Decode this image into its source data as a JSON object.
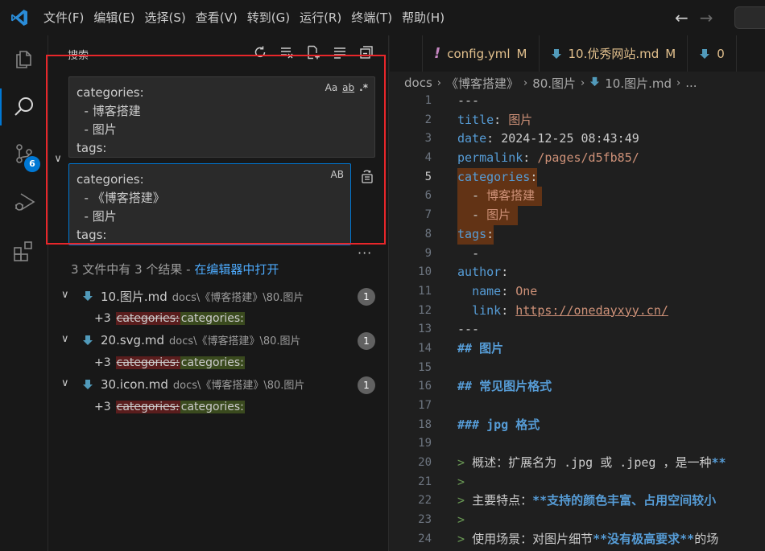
{
  "menu": [
    "文件(F)",
    "编辑(E)",
    "选择(S)",
    "查看(V)",
    "转到(G)",
    "运行(R)",
    "终端(T)",
    "帮助(H)"
  ],
  "activity": {
    "source_control_badge": "6"
  },
  "sidebar": {
    "title": "搜索",
    "search_lines": [
      "categories:",
      "  - 博客搭建",
      "  - 图片",
      "tags:"
    ],
    "search_opts": {
      "case": "Aa",
      "word": "ab",
      "regex": ".*"
    },
    "replace_lines": [
      "categories:",
      "  - 《博客搭建》",
      "  - 图片",
      "tags:"
    ],
    "replace_opts": {
      "preserve_case": "AB"
    },
    "summary_text": "3 文件中有 3 个结果 - ",
    "summary_link": "在编辑器中打开",
    "results": [
      {
        "name": "10.图片.md",
        "path": "docs\\《博客搭建》\\80.图片",
        "count": "1",
        "plus": "+3",
        "old": "categories:",
        "new": "categories:"
      },
      {
        "name": "20.svg.md",
        "path": "docs\\《博客搭建》\\80.图片",
        "count": "1",
        "plus": "+3",
        "old": "categories:",
        "new": "categories:"
      },
      {
        "name": "30.icon.md",
        "path": "docs\\《博客搭建》\\80.图片",
        "count": "1",
        "plus": "+3",
        "old": "categories:",
        "new": "categories:"
      }
    ]
  },
  "tabs": [
    {
      "label": "config.yml",
      "status": "M"
    },
    {
      "label": "10.优秀网站.md",
      "status": "M"
    },
    {
      "label": "0",
      "status": ""
    }
  ],
  "breadcrumb": [
    "docs",
    "《博客搭建》",
    "80.图片",
    "10.图片.md",
    "..."
  ],
  "code": {
    "l1": "---",
    "l2_key": "title",
    "l2_val": "图片",
    "l3_key": "date",
    "l3_val": "2024-12-25 08:43:49",
    "l4_key": "permalink",
    "l4_val": "/pages/d5fb85/",
    "l5_key": "categories",
    "l6_val": "博客搭建",
    "l7_val": "图片",
    "l8_key": "tags",
    "l9": "-",
    "l10_key": "author",
    "l11_key": "name",
    "l11_val": "One",
    "l12_key": "link",
    "l12_val": "https://onedayxyy.cn/",
    "l13": "---",
    "l14": "## 图片",
    "l16": "## 常见图片格式",
    "l18": "### jpg 格式",
    "l20_pre": "> ",
    "l20_text": "概述：扩展名为 .jpg 或 .jpeg ，是一种",
    "l20_bold": "**",
    "l21": ">",
    "l22_pre": "> ",
    "l22_text": "主要特点：",
    "l22_bold": "**支持的颜色丰富、占用空间较小",
    "l23": ">",
    "l24_pre": "> ",
    "l24_text": "使用场景：对图片细节",
    "l24_bold": "**没有极高要求**",
    "l24_tail": "的场"
  }
}
